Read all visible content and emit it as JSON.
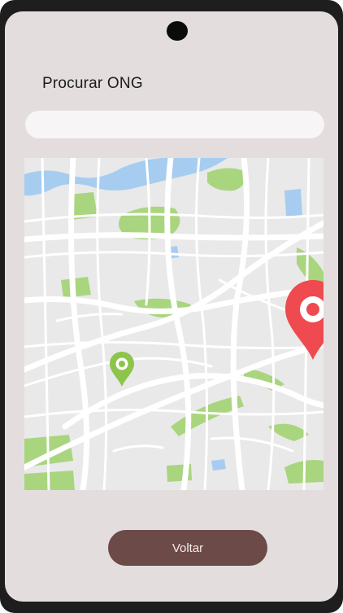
{
  "screen": {
    "title": "Procurar ONG"
  },
  "search": {
    "value": "",
    "placeholder": ""
  },
  "map": {
    "markers": [
      {
        "name": "current-location-pin",
        "color": "#8bc34a"
      },
      {
        "name": "destination-pin",
        "color": "#ee4a4f"
      }
    ],
    "colors": {
      "road": "#ffffff",
      "block": "#e8e8e8",
      "park": "#a8d67e",
      "water": "#9fc8ee"
    }
  },
  "actions": {
    "back_label": "Voltar"
  },
  "colors": {
    "background": "#e4dddd",
    "button": "#6b4a47",
    "frame": "#1e1e1e"
  }
}
